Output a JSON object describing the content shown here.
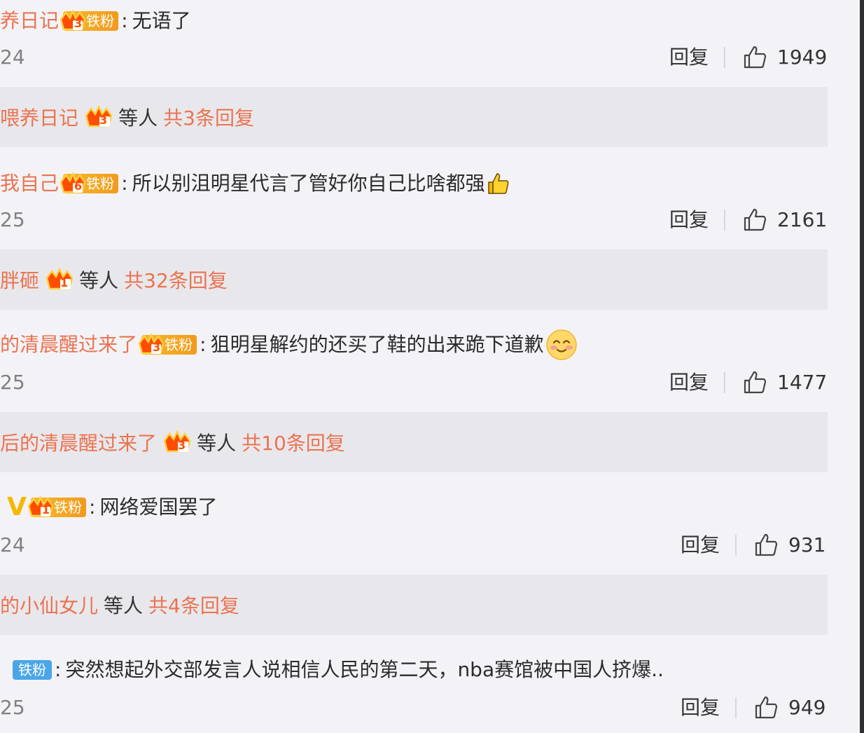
{
  "comments": [
    {
      "username": "养日记",
      "badge": "铁粉",
      "level": "3",
      "text": "无语了",
      "time": "24",
      "reply_label": "回复",
      "likes": "1949",
      "thread": {
        "names": "喂养日记",
        "level": "3",
        "etc": "等人",
        "total": "共3条回复"
      }
    },
    {
      "username": "我自己",
      "badge": "铁粉",
      "level": "6",
      "text": "所以别沮明星代言了管好你自己比啥都强",
      "emoji": "thumbs-up",
      "time": "25",
      "reply_label": "回复",
      "likes": "2161",
      "thread": {
        "names": "胖砸",
        "level": "1",
        "etc": "等人",
        "total": "共32条回复"
      }
    },
    {
      "username": "的清晨醒过来了",
      "badge": "铁粉",
      "level": "3",
      "text": "狙明星解约的还买了鞋的出来跪下道歉",
      "emoji": "blushing-face",
      "time": "25",
      "reply_label": "回复",
      "likes": "1477",
      "thread": {
        "names": "后的清晨醒过来了",
        "level": "3",
        "etc": "等人",
        "total": "共10条回复"
      }
    },
    {
      "username": "",
      "verified": "V",
      "badge": "铁粉",
      "level": "1",
      "text": "网络爱国罢了",
      "time": "24",
      "reply_label": "回复",
      "likes": "931",
      "thread": {
        "names": "的小仙女儿",
        "etc": "等人",
        "total": "共4条回复"
      }
    },
    {
      "username": "",
      "badge": "铁粉",
      "text": "突然想起外交部发言人说相信人民的第二天，nba赛馆被中国人挤爆..",
      "time": "25",
      "reply_label": "回复",
      "likes": "949"
    }
  ],
  "colors": {
    "username": "#eb7350",
    "badge_gold": "#f4a623",
    "badge_blue": "#4aa6e8",
    "background": "#f3f3f7",
    "reply_box": "#e8e8ec"
  }
}
